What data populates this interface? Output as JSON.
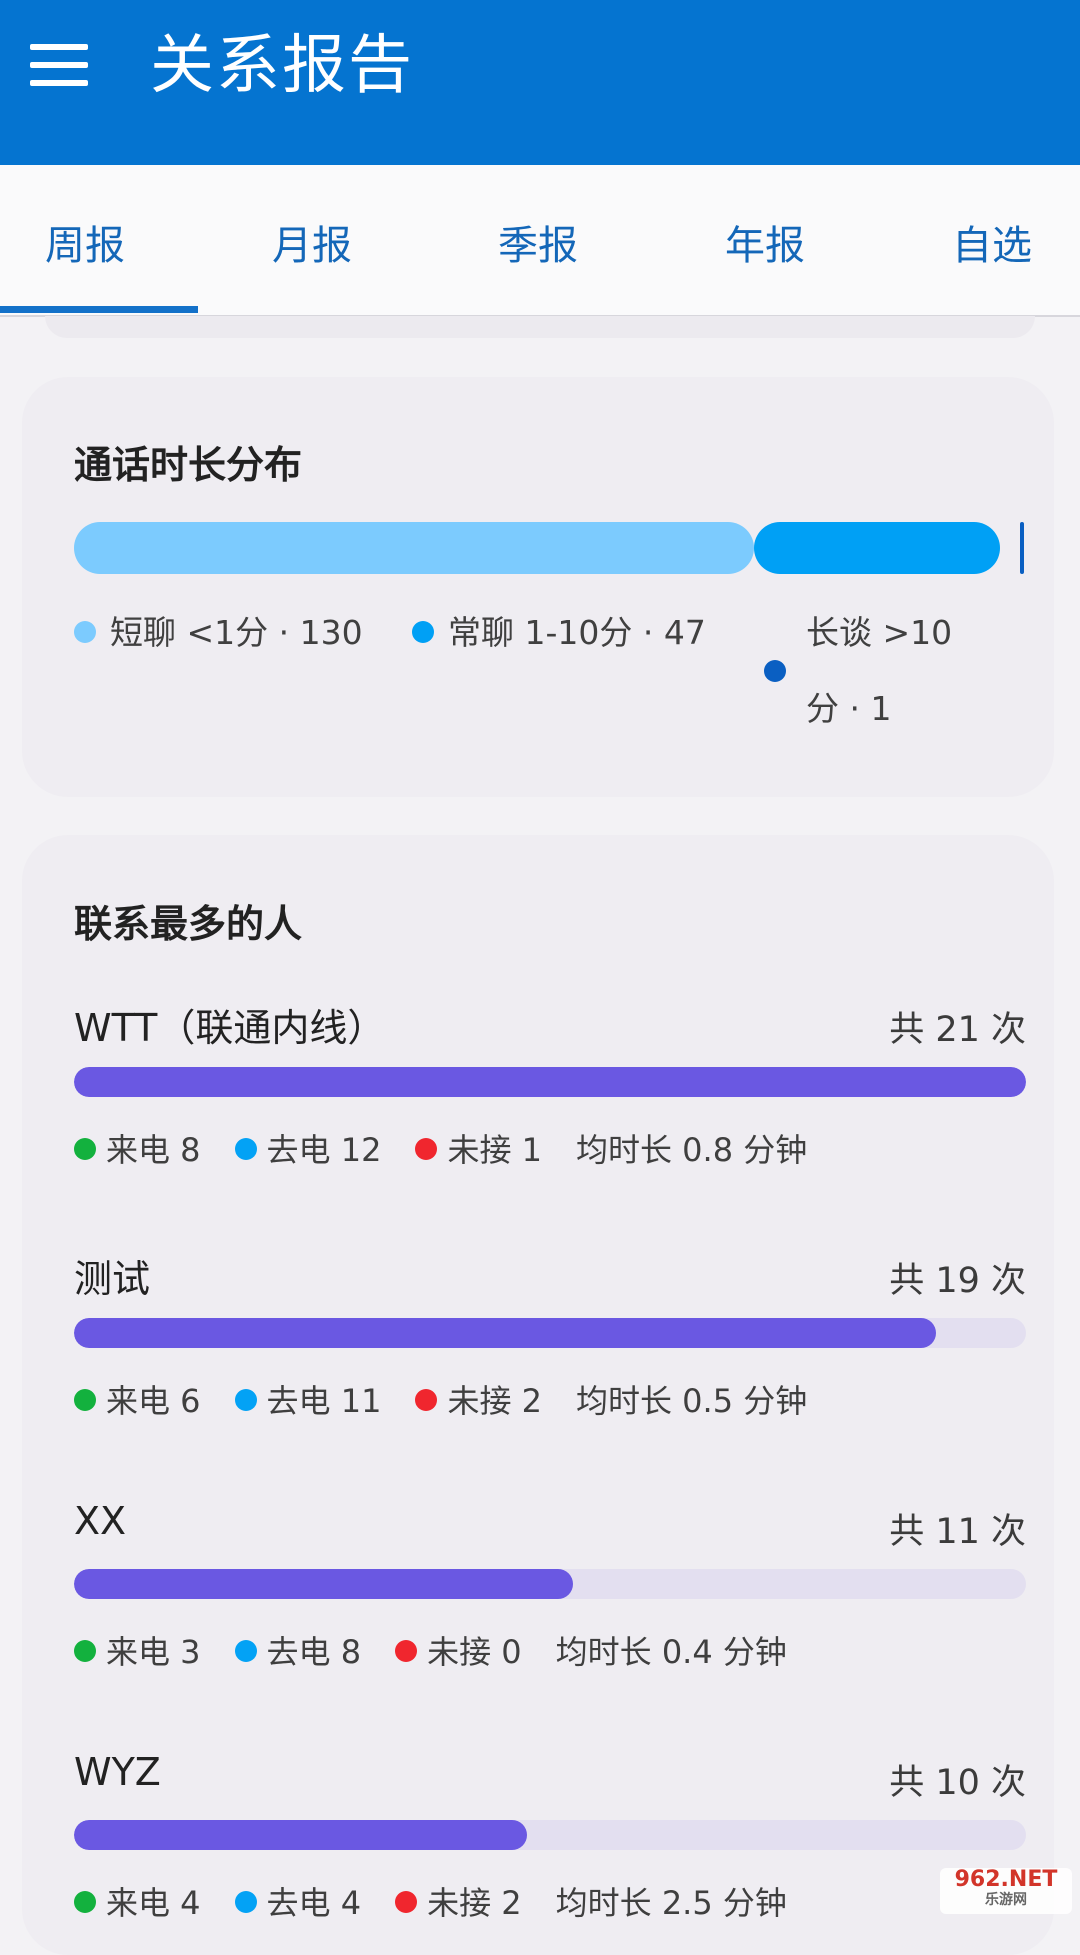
{
  "app_bar": {
    "title": "关系报告",
    "menu_icon": "menu-icon"
  },
  "tabs": [
    {
      "label": "周报",
      "selected": true
    },
    {
      "label": "月报",
      "selected": false
    },
    {
      "label": "季报",
      "selected": false
    },
    {
      "label": "年报",
      "selected": false
    },
    {
      "label": "自选",
      "selected": false
    }
  ],
  "duration_card": {
    "title": "通话时长分布",
    "segments": [
      {
        "label": "短聊 <1分 · 130",
        "count": 130,
        "color": "#7ccbfe"
      },
      {
        "label": "常聊 1-10分 · 47",
        "count": 47,
        "color": "#00a0f5"
      },
      {
        "label_line1": "长谈 >10",
        "label_line2": "分 · 1",
        "count": 1,
        "color": "#0a5fc2"
      }
    ]
  },
  "contacts_card": {
    "title": "联系最多的人",
    "contacts": [
      {
        "name": "WTT（联通内线）",
        "total": "共 21 次",
        "fraction": 1.0,
        "incoming": "来电 8",
        "outgoing": "去电 12",
        "missed": "未接 1",
        "avg": "均时长 0.8 分钟"
      },
      {
        "name": "测试",
        "total": "共 19 次",
        "fraction": 0.905,
        "incoming": "来电 6",
        "outgoing": "去电 11",
        "missed": "未接 2",
        "avg": "均时长 0.5 分钟"
      },
      {
        "name": "XX",
        "total": "共 11 次",
        "fraction": 0.524,
        "incoming": "来电 3",
        "outgoing": "去电 8",
        "missed": "未接 0",
        "avg": "均时长 0.4 分钟"
      },
      {
        "name": "WYZ",
        "total": "共 10 次",
        "fraction": 0.476,
        "incoming": "来电 4",
        "outgoing": "去电 4",
        "missed": "未接 2",
        "avg": "均时长 2.5 分钟"
      }
    ],
    "colors": {
      "incoming": "#13b13e",
      "outgoing": "#03a2f5",
      "missed": "#f0262e",
      "bar": "#6a58e2"
    }
  },
  "watermark": {
    "line1": "962.NET",
    "line2": "乐游网"
  }
}
